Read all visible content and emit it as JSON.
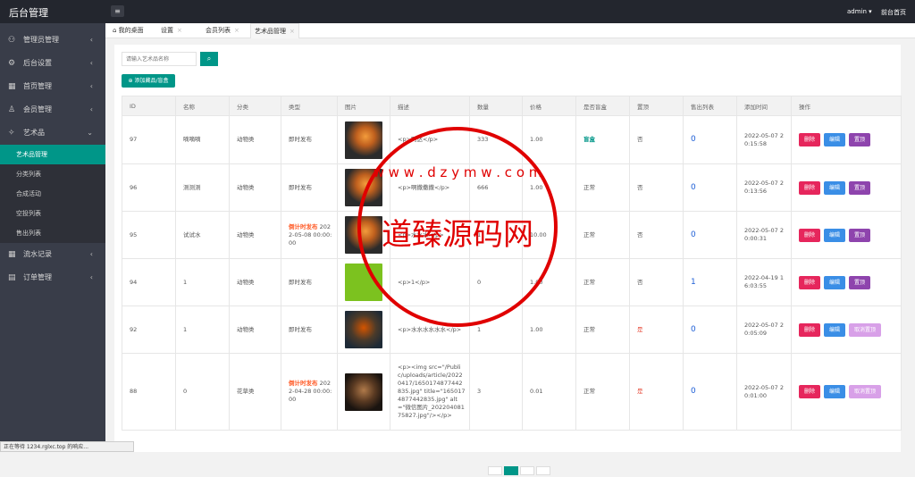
{
  "app": {
    "title": "后台管理",
    "user": "admin ▾",
    "home": "前台首页",
    "menu_icon": "menu-icon"
  },
  "sidebar": {
    "items": [
      {
        "label": "管理员管理",
        "icon": "user-icon",
        "arrow": "‹"
      },
      {
        "label": "后台设置",
        "icon": "gear-icon",
        "arrow": "‹"
      },
      {
        "label": "首页管理",
        "icon": "grid-icon",
        "arrow": "‹"
      },
      {
        "label": "会员管理",
        "icon": "member-icon",
        "arrow": "‹"
      },
      {
        "label": "艺术品",
        "icon": "pin-icon",
        "arrow": "⌄"
      }
    ],
    "subitems": [
      "艺术品管理",
      "分类列表",
      "合成活动",
      "空投列表",
      "售出列表"
    ],
    "items2": [
      {
        "label": "流水记录",
        "icon": "grid-icon",
        "arrow": "‹"
      },
      {
        "label": "订单管理",
        "icon": "doc-icon",
        "arrow": "‹"
      }
    ]
  },
  "tabs": [
    {
      "label": "我的桌面",
      "icon": "home-icon"
    },
    {
      "label": "设置",
      "close": "×"
    },
    {
      "label": "会员列表",
      "close": "×"
    },
    {
      "label": "艺术品管理",
      "close": "×"
    }
  ],
  "search": {
    "placeholder": "请输入艺术品名称",
    "button_icon": "search-icon"
  },
  "add_button": "⊕ 添加藏品/盲盒",
  "table": {
    "headers": [
      "ID",
      "名称",
      "分类",
      "类型",
      "图片",
      "描述",
      "数量",
      "价格",
      "是否盲盒",
      "置顶",
      "售出列表",
      "添加时间",
      "操作"
    ],
    "rows": [
      {
        "id": "97",
        "name": "嘀嘀嘀",
        "cat": "动物类",
        "type": "即时发布",
        "type_tag": "",
        "type_rest": "",
        "desc": "<p>阿达</p>",
        "qty": "333",
        "price": "1.00",
        "box": "盲盒",
        "top": "否",
        "sold": "0",
        "time": "2022-05-07 20:15:58",
        "btn3": "置顶",
        "img": "orange"
      },
      {
        "id": "96",
        "name": "测测测",
        "cat": "动物类",
        "type": "即时发布",
        "type_tag": "",
        "type_rest": "",
        "desc": "<p>啊撒撒撒</p>",
        "qty": "666",
        "price": "1.00",
        "box": "正常",
        "top": "否",
        "sold": "0",
        "time": "2022-05-07 20:13:56",
        "btn3": "置顶",
        "img": "orange"
      },
      {
        "id": "95",
        "name": "试试水",
        "cat": "动物类",
        "type": "",
        "type_tag": "倒计时发布",
        "type_rest": " 2022-05-08 00:00:00",
        "desc": "<p>水水水</p>",
        "qty": "1",
        "price": "10.00",
        "box": "正常",
        "top": "否",
        "sold": "0",
        "time": "2022-05-07 20:00:31",
        "btn3": "置顶",
        "img": "orange"
      },
      {
        "id": "94",
        "name": "1",
        "cat": "动物类",
        "type": "即时发布",
        "type_tag": "",
        "type_rest": "",
        "desc": "<p>1</p>",
        "qty": "0",
        "price": "1.00",
        "box": "正常",
        "top": "否",
        "sold": "1",
        "time": "2022-04-19 16:03:55",
        "btn3": "置顶",
        "img": "green"
      },
      {
        "id": "92",
        "name": "1",
        "cat": "动物类",
        "type": "即时发布",
        "type_tag": "",
        "type_rest": "",
        "desc": "<p>水水水水水水</p>",
        "qty": "1",
        "price": "1.00",
        "box": "正常",
        "top": "是",
        "sold": "0",
        "time": "2022-05-07 20:05:09",
        "btn3": "取消置顶",
        "img": "dark"
      },
      {
        "id": "88",
        "name": "0",
        "cat": "花草类",
        "type": "",
        "type_tag": "倒计时发布",
        "type_rest": " 2022-04-28 00:00:00",
        "desc": "<p><img src=\"/Public/uploads/article/20220417/1650174877442835.jpg\" title=\"1650174877442835.jpg\" alt=\"微信图片_20220408175827.jpg\"/></p>",
        "qty": "3",
        "price": "0.01",
        "box": "正常",
        "top": "是",
        "sold": "0",
        "time": "2022-05-07 20:01:00",
        "btn3": "取消置顶",
        "img": "brown"
      }
    ],
    "btn_delete": "删除",
    "btn_edit": "编辑"
  },
  "statusbar": "正在等待 1234.rglxc.top 的响应...",
  "watermark": {
    "line1": "w w w . d z y m w . c o m",
    "main": "道臻源码网"
  },
  "colors": {
    "accent": "#009688",
    "header": "#23262e",
    "sidebar": "#393d49",
    "delete": "#e6265c",
    "edit": "#3a8ee6",
    "top": "#8e44ad",
    "stamp": "#e00000"
  }
}
